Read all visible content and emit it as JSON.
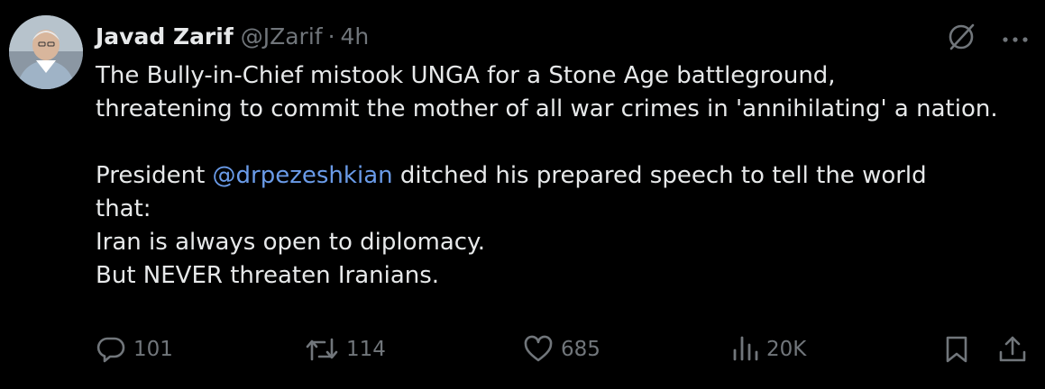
{
  "tweet": {
    "author_name": "Javad Zarif",
    "handle": "@JZarif",
    "separator": "·",
    "time": "4h",
    "lines": {
      "l1": "The Bully-in-Chief mistook UNGA for a Stone Age battleground,",
      "l2": "threatening to commit the mother of all war crimes in 'annihilating' a nation.",
      "l3_prefix": "President ",
      "l3_mention": "@drpezeshkian",
      "l3_suffix": " ditched his prepared speech to tell the world",
      "l4": "that:",
      "l5": "Iran is always open to diplomacy.",
      "l6": "But NEVER threaten Iranians."
    }
  },
  "icons": {
    "grok": "grok-icon",
    "more": "more-icon",
    "reply": "reply-icon",
    "retweet": "retweet-icon",
    "like": "like-icon",
    "views": "views-icon",
    "bookmark": "bookmark-icon",
    "share": "share-icon"
  },
  "actions": {
    "replies": "101",
    "retweets": "114",
    "likes": "685",
    "views": "20K"
  },
  "colors": {
    "background": "#000000",
    "text": "#e7e9ea",
    "secondary": "#71767b",
    "mention": "#6a9be8"
  }
}
